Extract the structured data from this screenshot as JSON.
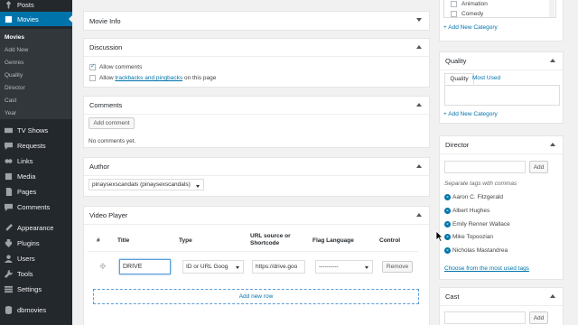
{
  "sidebar": {
    "items": [
      {
        "label": "Posts",
        "icon": "pin-icon"
      },
      {
        "label": "Movies",
        "icon": "film-icon"
      },
      {
        "label": "TV Shows",
        "icon": "tv-icon"
      },
      {
        "label": "Requests",
        "icon": "chat-icon"
      },
      {
        "label": "Links",
        "icon": "link-icon"
      },
      {
        "label": "Media",
        "icon": "media-icon"
      },
      {
        "label": "Pages",
        "icon": "page-icon"
      },
      {
        "label": "Comments",
        "icon": "comment-icon"
      },
      {
        "label": "Appearance",
        "icon": "brush-icon"
      },
      {
        "label": "Plugins",
        "icon": "plugin-icon"
      },
      {
        "label": "Users",
        "icon": "user-icon"
      },
      {
        "label": "Tools",
        "icon": "wrench-icon"
      },
      {
        "label": "Settings",
        "icon": "settings-icon"
      },
      {
        "label": "dbmovies",
        "icon": "db-icon"
      }
    ],
    "submenu": [
      "Movies",
      "Add New",
      "Genres",
      "Quality",
      "Director",
      "Cast",
      "Year"
    ]
  },
  "movie_info": {
    "title": "Movie Info"
  },
  "discussion": {
    "title": "Discussion",
    "allow_comments": "Allow comments",
    "allow_prefix": "Allow",
    "allow_link": "trackbacks and pingbacks",
    "allow_suffix": "on this page"
  },
  "comments": {
    "title": "Comments",
    "add_button": "Add comment",
    "empty": "No comments yet."
  },
  "author": {
    "title": "Author",
    "selected": "pinaysexscandals (pinaysexscandals)"
  },
  "video_player": {
    "title": "Video Player",
    "headers": {
      "num": "#",
      "title": "Title",
      "type": "Type",
      "url_line1": "URL source or",
      "url_line2": "Shortcode",
      "flag": "Flag Language",
      "control": "Control"
    },
    "row": {
      "title": "DRIVE",
      "type": "ID or URL Goog",
      "url": "https://drive.goo",
      "flag": "----------",
      "remove": "Remove"
    },
    "add_row": "Add new row"
  },
  "genres": {
    "items": [
      "Animation",
      "Comedy"
    ],
    "add_link": "+ Add New Category"
  },
  "quality": {
    "title": "Quality",
    "tab_active": "Quality",
    "tab_other": "Most Used",
    "add_link": "+ Add New Category"
  },
  "director": {
    "title": "Director",
    "add_button": "Add",
    "hint": "Separate tags with commas",
    "tags": [
      "Aaron C. Fitzgerald",
      "Albert Hughes",
      "Emily Renner Wallace",
      "Mike Topoozian",
      "Nicholas Mastandrea"
    ],
    "choose_link": "Choose from the most used tags"
  },
  "cast": {
    "title": "Cast",
    "add_button": "Add"
  },
  "colors": {
    "sidebar": "#23282d",
    "active": "#0073aa",
    "link": "#0073aa"
  }
}
